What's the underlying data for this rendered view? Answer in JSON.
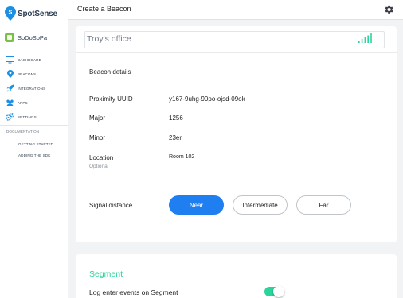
{
  "app": {
    "name": "SpotSense",
    "org_name": "SoDoSoPa"
  },
  "sidebar": {
    "items": [
      {
        "label": "DASHBOARD",
        "icon": "monitor-icon"
      },
      {
        "label": "BEACONS",
        "icon": "location-pin-icon"
      },
      {
        "label": "INTEGRATIONS",
        "icon": "rocket-icon"
      },
      {
        "label": "APPS",
        "icon": "users-icon"
      },
      {
        "label": "SETTINGS",
        "icon": "gears-icon"
      }
    ],
    "documentation": {
      "title": "DOCUMENTATION",
      "links": [
        "GETTING STARTED",
        "ADDING THE SDK"
      ]
    }
  },
  "header": {
    "title": "Create a Beacon",
    "settings_icon": "gear-icon"
  },
  "beacon": {
    "name": "Troy's office",
    "details_title": "Beacon details",
    "fields": {
      "uuid": {
        "label": "Proximity UUID",
        "value": "y167-9uhg-90po-ojsd-09ok"
      },
      "major": {
        "label": "Major",
        "value": "1256"
      },
      "minor": {
        "label": "Minor",
        "value": "23er"
      },
      "location": {
        "label": "Location",
        "sublabel": "Optional",
        "value": "Room 102"
      }
    },
    "signal_distance": {
      "label": "Signal distance",
      "options": [
        "Near",
        "Intermediate",
        "Far"
      ],
      "selected": "Near"
    }
  },
  "segment": {
    "title": "Segment",
    "log_enter_label": "Log enter events on Segment",
    "log_enter_enabled": true
  },
  "colors": {
    "accent_blue": "#1f7ff0",
    "accent_green": "#2bd39d",
    "brand_blue": "#1a8fe3",
    "org_green": "#7ac143"
  }
}
